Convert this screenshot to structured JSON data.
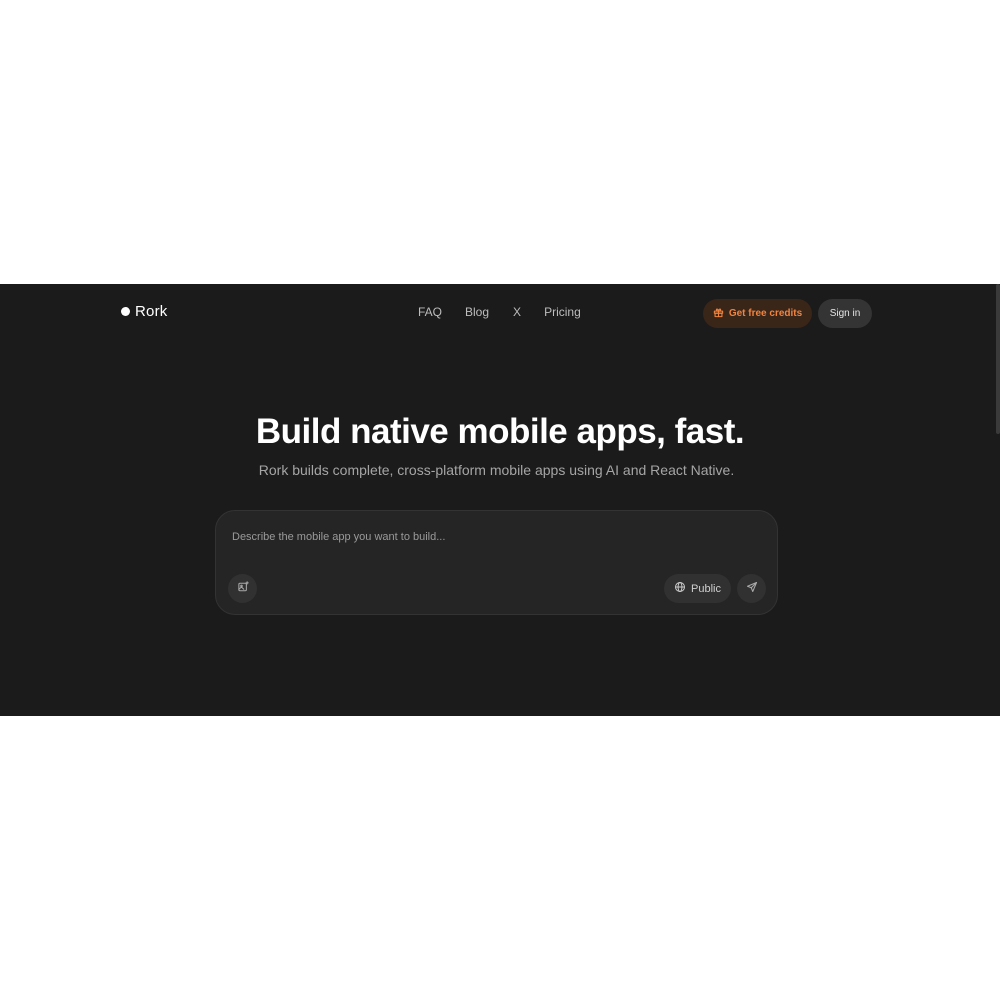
{
  "header": {
    "logo_text": "Rork",
    "nav": [
      "FAQ",
      "Blog",
      "X",
      "Pricing"
    ],
    "credits_label": "Get free credits",
    "signin_label": "Sign in"
  },
  "hero": {
    "title": "Build native mobile apps, fast.",
    "subtitle": "Rork builds complete, cross-platform mobile apps using AI and React Native."
  },
  "prompt": {
    "placeholder": "Describe the mobile app you want to build...",
    "visibility_label": "Public",
    "icons": [
      "image-upload-icon",
      "globe-icon",
      "send-icon"
    ]
  },
  "colors": {
    "background": "#1b1b1b",
    "accent": "#f0843f",
    "accent_bg": "#3a2519"
  }
}
